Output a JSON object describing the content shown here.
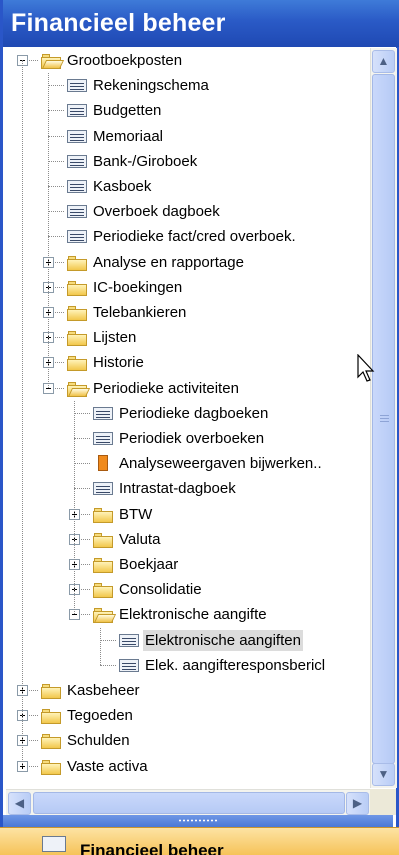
{
  "window": {
    "title": "Financieel beheer"
  },
  "tree": {
    "items": [
      {
        "label": "Grootboekposten",
        "level": 0,
        "type": "openfolder",
        "expanded": true
      },
      {
        "label": "Rekeningschema",
        "level": 1,
        "type": "doc"
      },
      {
        "label": "Budgetten",
        "level": 1,
        "type": "doc"
      },
      {
        "label": "Memoriaal",
        "level": 1,
        "type": "doc"
      },
      {
        "label": "Bank-/Giroboek",
        "level": 1,
        "type": "doc"
      },
      {
        "label": "Kasboek",
        "level": 1,
        "type": "doc"
      },
      {
        "label": "Overboek dagboek",
        "level": 1,
        "type": "doc"
      },
      {
        "label": "Periodieke fact/cred overboek.",
        "level": 1,
        "type": "doc"
      },
      {
        "label": "Analyse en rapportage",
        "level": 1,
        "type": "folder",
        "expanded": false
      },
      {
        "label": "IC-boekingen",
        "level": 1,
        "type": "folder",
        "expanded": false
      },
      {
        "label": "Telebankieren",
        "level": 1,
        "type": "folder",
        "expanded": false
      },
      {
        "label": "Lijsten",
        "level": 1,
        "type": "folder",
        "expanded": false
      },
      {
        "label": "Historie",
        "level": 1,
        "type": "folder",
        "expanded": false
      },
      {
        "label": "Periodieke activiteiten",
        "level": 1,
        "type": "openfolder",
        "expanded": true
      },
      {
        "label": "Periodieke dagboeken",
        "level": 2,
        "type": "doc"
      },
      {
        "label": "Periodiek overboeken",
        "level": 2,
        "type": "doc"
      },
      {
        "label": "Analyseweergaven bijwerken..",
        "level": 2,
        "type": "report"
      },
      {
        "label": "Intrastat-dagboek",
        "level": 2,
        "type": "doc"
      },
      {
        "label": "BTW",
        "level": 2,
        "type": "folder",
        "expanded": false
      },
      {
        "label": "Valuta",
        "level": 2,
        "type": "folder",
        "expanded": false
      },
      {
        "label": "Boekjaar",
        "level": 2,
        "type": "folder",
        "expanded": false
      },
      {
        "label": "Consolidatie",
        "level": 2,
        "type": "folder",
        "expanded": false
      },
      {
        "label": "Elektronische aangifte",
        "level": 2,
        "type": "openfolder",
        "expanded": true
      },
      {
        "label": "Elektronische aangiften",
        "level": 3,
        "type": "doc",
        "selected": true
      },
      {
        "label": "Elek. aangifteresponsbericl",
        "level": 3,
        "type": "doc"
      },
      {
        "label": "Kasbeheer",
        "level": 0,
        "type": "folder",
        "expanded": false
      },
      {
        "label": "Tegoeden",
        "level": 0,
        "type": "folder",
        "expanded": false
      },
      {
        "label": "Schulden",
        "level": 0,
        "type": "folder",
        "expanded": false
      },
      {
        "label": "Vaste activa",
        "level": 0,
        "type": "folder",
        "expanded": false
      }
    ]
  },
  "nav_button": {
    "label": "Financieel beheer"
  },
  "colors": {
    "title_blue": "#2a5ac6",
    "nav_orange": "#f6c359",
    "selection": "#dcdcdc"
  }
}
